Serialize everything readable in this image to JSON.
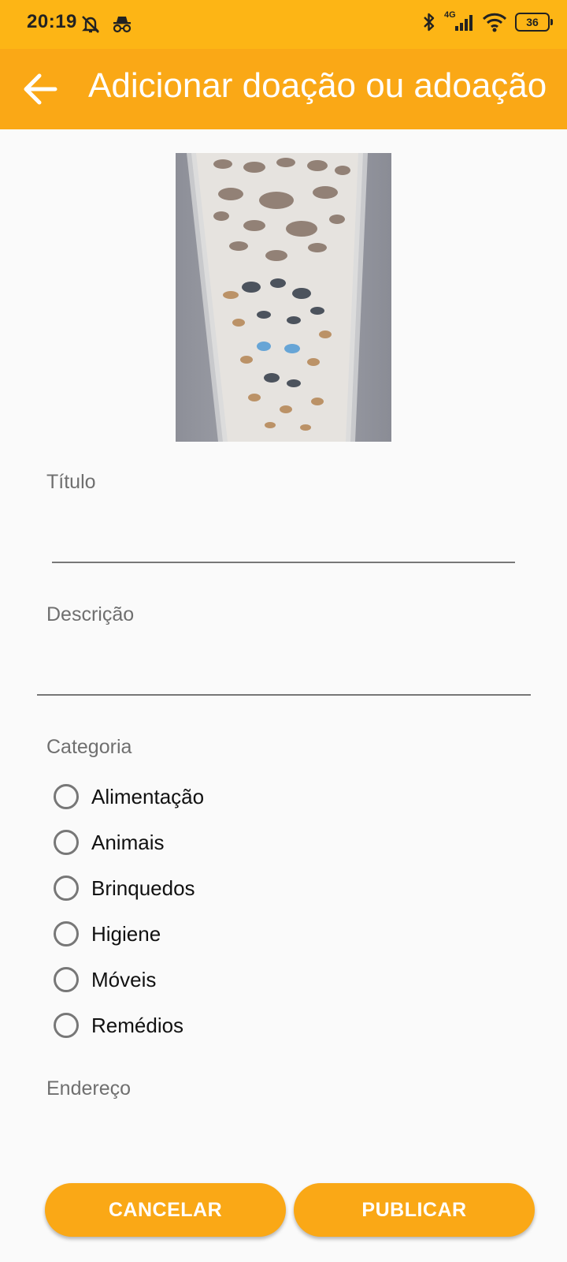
{
  "status_bar": {
    "time": "20:19",
    "network": "4G",
    "battery": "36"
  },
  "toolbar": {
    "title": "Adicionar doação ou adoação"
  },
  "form": {
    "titulo_label": "Título",
    "descricao_label": "Descrição",
    "categoria_label": "Categoria",
    "categorias": [
      "Alimentação",
      "Animais",
      "Brinquedos",
      "Higiene",
      "Móveis",
      "Remédios"
    ],
    "endereco_label": "Endereço"
  },
  "buttons": {
    "cancel": "CANCELAR",
    "publish": "PUBLICAR"
  },
  "colors": {
    "status_bar": "#FDB515",
    "toolbar": "#FAA816",
    "button": "#FAA816"
  }
}
